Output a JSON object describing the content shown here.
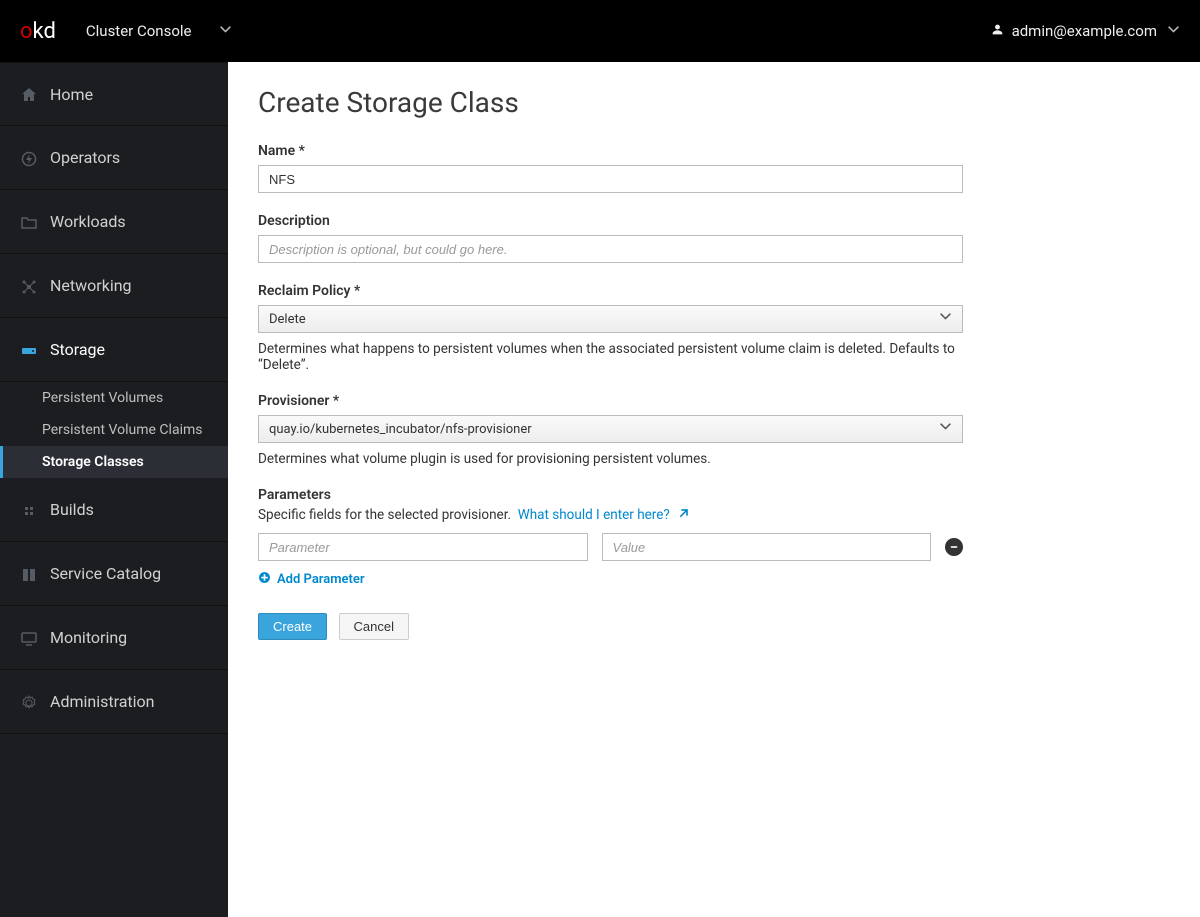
{
  "header": {
    "brand_prefix": "o",
    "brand_suffix": "kd",
    "console_switch": "Cluster Console",
    "user": "admin@example.com"
  },
  "sidebar": {
    "items": [
      {
        "label": "Home",
        "icon": "home"
      },
      {
        "label": "Operators",
        "icon": "bolt"
      },
      {
        "label": "Workloads",
        "icon": "folder"
      },
      {
        "label": "Networking",
        "icon": "network"
      },
      {
        "label": "Storage",
        "icon": "hdd",
        "expanded": true,
        "children": [
          {
            "label": "Persistent Volumes"
          },
          {
            "label": "Persistent Volume Claims"
          },
          {
            "label": "Storage Classes",
            "active": true
          }
        ]
      },
      {
        "label": "Builds",
        "icon": "cubes"
      },
      {
        "label": "Service Catalog",
        "icon": "book"
      },
      {
        "label": "Monitoring",
        "icon": "monitor"
      },
      {
        "label": "Administration",
        "icon": "gear"
      }
    ]
  },
  "page": {
    "title": "Create Storage Class",
    "fields": {
      "name": {
        "label": "Name *",
        "value": "NFS"
      },
      "description": {
        "label": "Description",
        "placeholder": "Description is optional, but could go here."
      },
      "reclaim": {
        "label": "Reclaim Policy *",
        "value": "Delete",
        "help": "Determines what happens to persistent volumes when the associated persistent volume claim is deleted. Defaults to “Delete”."
      },
      "provisioner": {
        "label": "Provisioner *",
        "value": "quay.io/kubernetes_incubator/nfs-provisioner",
        "help": "Determines what volume plugin is used for provisioning persistent volumes."
      }
    },
    "parameters": {
      "label": "Parameters",
      "desc": "Specific fields for the selected provisioner.",
      "help_link": "What should I enter here?",
      "row": {
        "key_placeholder": "Parameter",
        "value_placeholder": "Value"
      },
      "add_label": "Add Parameter"
    },
    "buttons": {
      "create": "Create",
      "cancel": "Cancel"
    }
  }
}
